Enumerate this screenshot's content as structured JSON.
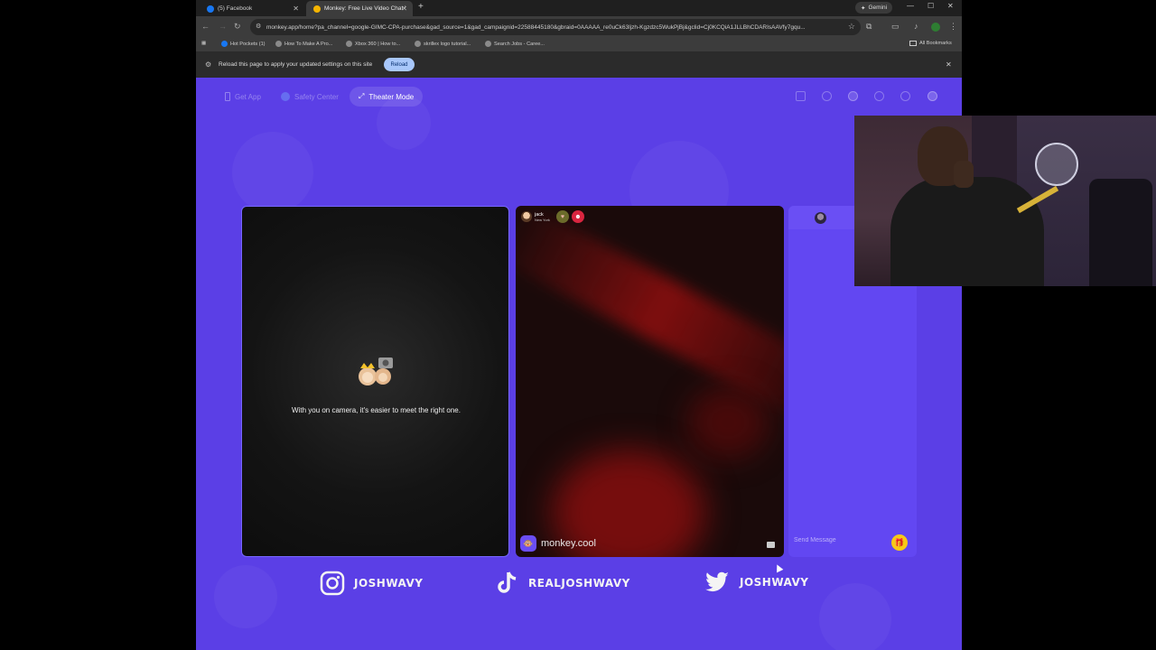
{
  "browser": {
    "tabs": [
      {
        "title": "(5) Facebook",
        "favicon_color": "#1877f2",
        "active": false
      },
      {
        "title": "Monkey: Free Live Video Chat Wi",
        "favicon_color": "#f4b400",
        "active": true
      }
    ],
    "gemini_label": "Gemini",
    "url": "monkey.app/home?pa_channel=google-GIMC-CPA-purchase&gad_source=1&gad_campaignid=22588445180&gbraid=0AAAAA_re0uCk63ljzh-Kgzdzc5WukPjBj&gclid=Cj0KCQiA1JLLBhCDARIsAAVfy7gqu...",
    "bookmarks": [
      "Hot Pockets (1)",
      "How To Make A Pro...",
      "Xbox 360 | How to...",
      "skrillex logo tutorial...",
      "Search Jobs - Caree..."
    ],
    "all_bookmarks_label": "All Bookmarks",
    "infobar": {
      "message": "Reload this page to apply your updated settings on this site",
      "reload_label": "Reload"
    }
  },
  "site": {
    "nav": {
      "get_app": "Get App",
      "safety_center": "Safety Center",
      "theater_mode": "Theater Mode"
    },
    "left_card": {
      "prompt": "With you on camera, it's easier to meet the right one."
    },
    "mid_card": {
      "user_name": "jack",
      "user_location": "New York",
      "watermark": "monkey.cool"
    },
    "chat": {
      "placeholder": "Send Message"
    },
    "socials": [
      {
        "platform": "instagram",
        "handle": "JOSHWAVY"
      },
      {
        "platform": "tiktok",
        "handle": "REALJOSHWAVY"
      },
      {
        "platform": "twitter",
        "handle": "JOSHWAVY"
      }
    ],
    "colors": {
      "brand_purple": "#5b3fe6",
      "gift_yellow": "#f7c817",
      "reload_blue": "#a8c7fa"
    }
  }
}
